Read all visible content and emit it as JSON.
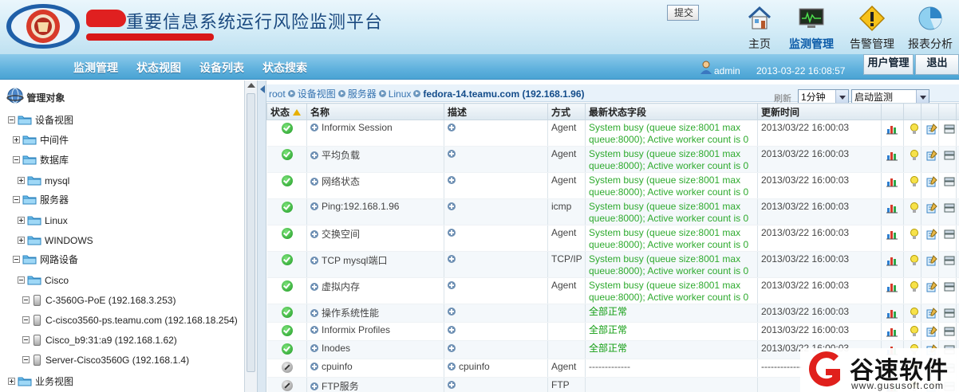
{
  "header": {
    "title": "重要信息系统运行风险监测平台",
    "nav": [
      {
        "label": "主页",
        "icon": "home-icon"
      },
      {
        "label": "监测管理",
        "icon": "monitor-icon",
        "active": true
      },
      {
        "label": "告警管理",
        "icon": "warning-icon"
      },
      {
        "label": "报表分析",
        "icon": "pie-chart-icon"
      }
    ]
  },
  "menubar": {
    "items": [
      "监测管理",
      "状态视图",
      "设备列表",
      "状态搜索"
    ],
    "user": "admin",
    "datetime": "2013-03-22 16:08:57",
    "user_mgmt": "用户管理",
    "logout": "退出"
  },
  "sidebar": {
    "root": "管理对象",
    "tree": [
      {
        "label": "设备视图",
        "toggle": "minus",
        "kind": "folder"
      },
      {
        "label": "中间件",
        "toggle": "plus",
        "kind": "folder"
      },
      {
        "label": "数据库",
        "toggle": "minus",
        "kind": "folder"
      },
      {
        "label": "mysql",
        "toggle": "plus",
        "kind": "folder"
      },
      {
        "label": "服务器",
        "toggle": "minus",
        "kind": "folder"
      },
      {
        "label": "Linux",
        "toggle": "plus",
        "kind": "folder"
      },
      {
        "label": "WINDOWS",
        "toggle": "plus",
        "kind": "folder"
      },
      {
        "label": "网路设备",
        "toggle": "minus",
        "kind": "folder"
      },
      {
        "label": "Cisco",
        "toggle": "minus",
        "kind": "folder"
      },
      {
        "label": "C-3560G-PoE (192.168.3.253)",
        "toggle": "minus",
        "kind": "device"
      },
      {
        "label": "C-cisco3560-ps.teamu.com (192.168.18.254)",
        "toggle": "minus",
        "kind": "device"
      },
      {
        "label": "Cisco_b9:31:a9 (192.168.1.62)",
        "toggle": "minus",
        "kind": "device"
      },
      {
        "label": "Server-Cisco3560G (192.168.1.4)",
        "toggle": "minus",
        "kind": "device"
      },
      {
        "label": "业务视图",
        "toggle": "plus",
        "kind": "folder"
      }
    ]
  },
  "toolbar": {
    "breadcrumb": [
      "root",
      "设备视图",
      "服务器",
      "Linux",
      "fedora-14.teamu.com (192.168.1.96)"
    ],
    "refresh_label": "刷新",
    "interval": "1分钟",
    "monitor_action": "启动监测",
    "submit": "提交"
  },
  "table": {
    "headers": [
      "状态",
      "名称",
      "描述",
      "方式",
      "最新状态字段",
      "更新时间",
      "",
      "",
      "",
      "",
      ""
    ],
    "rows": [
      {
        "status": "ok",
        "name": "Informix Session",
        "desc": "",
        "method": "Agent",
        "state": "System busy (queue size:8001 max queue:8000); Active worker count is 0",
        "time": "2013/03/22 16:00:03",
        "tall": true
      },
      {
        "status": "ok",
        "name": "平均负载",
        "desc": "",
        "method": "Agent",
        "state": "System busy (queue size:8001 max queue:8000); Active worker count is 0",
        "time": "2013/03/22 16:00:03",
        "tall": true
      },
      {
        "status": "ok",
        "name": "网络状态",
        "desc": "",
        "method": "Agent",
        "state": "System busy (queue size:8001 max queue:8000); Active worker count is 0",
        "time": "2013/03/22 16:00:03",
        "tall": true
      },
      {
        "status": "ok",
        "name": "Ping:192.168.1.96",
        "desc": "",
        "method": "icmp",
        "state": "System busy (queue size:8001 max queue:8000); Active worker count is 0",
        "time": "2013/03/22 16:00:03",
        "tall": true
      },
      {
        "status": "ok",
        "name": "交换空间",
        "desc": "",
        "method": "Agent",
        "state": "System busy (queue size:8001 max queue:8000); Active worker count is 0",
        "time": "2013/03/22 16:00:03",
        "tall": true
      },
      {
        "status": "ok",
        "name": "TCP mysql端口",
        "desc": "",
        "method": "TCP/IP",
        "state": "System busy (queue size:8001 max queue:8000); Active worker count is 0",
        "time": "2013/03/22 16:00:03",
        "tall": true
      },
      {
        "status": "ok",
        "name": "虚拟内存",
        "desc": "",
        "method": "Agent",
        "state": "System busy (queue size:8001 max queue:8000); Active worker count is 0",
        "time": "2013/03/22 16:00:03",
        "tall": true
      },
      {
        "status": "ok",
        "name": "操作系统性能",
        "desc": "",
        "method": "",
        "state": "全部正常",
        "time": "2013/03/22 16:00:03",
        "tall": false
      },
      {
        "status": "ok",
        "name": "Informix Profiles",
        "desc": "",
        "method": "",
        "state": "全部正常",
        "time": "2013/03/22 16:00:03",
        "tall": false
      },
      {
        "status": "ok",
        "name": "Inodes",
        "desc": "",
        "method": "",
        "state": "全部正常",
        "time": "2013/03/22 16:00:03",
        "tall": false
      },
      {
        "status": "off",
        "name": "cpuinfo",
        "desc": "cpuinfo",
        "method": "Agent",
        "state": "-------------",
        "time": "-------------",
        "tall": false
      },
      {
        "status": "off",
        "name": "FTP服务",
        "desc": "",
        "method": "FTP",
        "state": "",
        "time": "",
        "tall": false
      }
    ]
  },
  "watermark": {
    "text": "谷速软件",
    "url": "www.gususoft.com"
  },
  "colors": {
    "brand_blue": "#1b4a80",
    "menubar": "#5fb1dd",
    "status_green": "#2eaa2e",
    "watermark_red": "#e0201c"
  }
}
